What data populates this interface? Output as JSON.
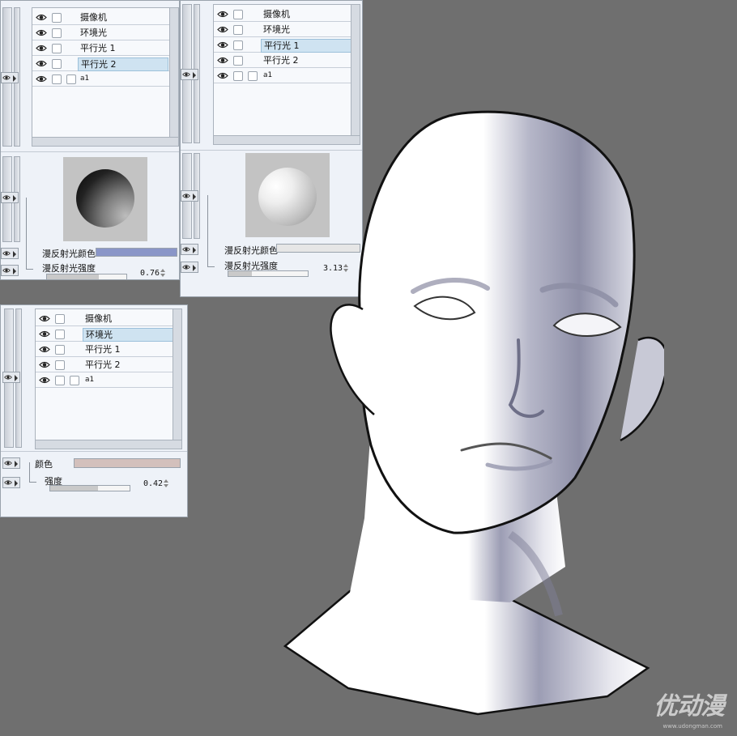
{
  "panels": [
    {
      "tree": [
        "摄像机",
        "环境光",
        "平行光 1",
        "平行光 2",
        "a1"
      ],
      "selected_index": 3,
      "diffuse_color_label": "漫反射光颜色",
      "diffuse_color": "#8a96c8",
      "diffuse_strength_label": "漫反射光强度",
      "strength_value": "0.76",
      "strength_fraction": 0.65
    },
    {
      "tree": [
        "摄像机",
        "环境光",
        "平行光 1",
        "平行光 2",
        "a1"
      ],
      "selected_index": 2,
      "diffuse_color_label": "漫反射光颜色",
      "diffuse_color": "#e6e6e6",
      "diffuse_strength_label": "漫反射光强度",
      "strength_value": "3.13",
      "strength_fraction": 0.3
    },
    {
      "tree": [
        "摄像机",
        "环境光",
        "平行光 1",
        "平行光 2",
        "a1"
      ],
      "selected_index": 1,
      "color_label": "颜色",
      "color": "#d3c0bc",
      "strength_label": "强度",
      "strength_value": "0.42",
      "strength_fraction": 0.6
    }
  ],
  "watermark": "优动漫",
  "watermark_sub": "www.udongman.com"
}
